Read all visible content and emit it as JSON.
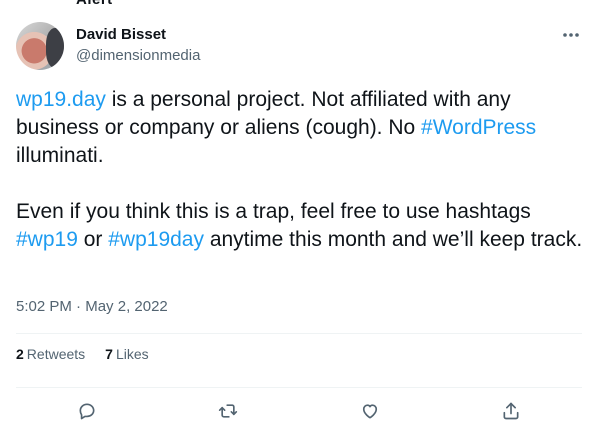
{
  "top_fragment": "Alert",
  "author": {
    "name": "David Bisset",
    "handle": "@dimensionmedia"
  },
  "tweet": {
    "p1_link1": "wp19.day",
    "p1_text1": " is a personal project. Not affiliated with any business or company or aliens (cough). No ",
    "p1_link2": "#WordPress",
    "p1_text2": " illuminati.",
    "p2_text1": "Even if you think this is a trap, feel free to use hashtags ",
    "p2_link1": "#wp19",
    "p2_text2": " or ",
    "p2_link2": "#wp19day",
    "p2_text3": " anytime this month and we’ll keep track."
  },
  "meta": {
    "time": "5:02 PM",
    "separator": " · ",
    "date": "May 2, 2022"
  },
  "stats": {
    "retweets_count": "2",
    "retweets_label": "Retweets",
    "likes_count": "7",
    "likes_label": "Likes"
  },
  "colors": {
    "accent": "#1d9bf0",
    "secondary_text": "#536471",
    "primary_text": "#0f1419",
    "divider": "#eff3f4"
  },
  "icons": {
    "more": "more-dots-icon",
    "reply": "reply-icon",
    "retweet": "retweet-icon",
    "like": "heart-icon",
    "share": "share-icon"
  }
}
